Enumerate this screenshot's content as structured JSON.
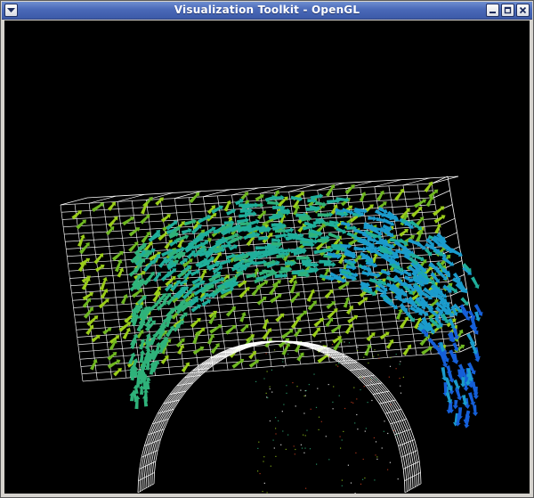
{
  "window": {
    "title": "Visualization Toolkit - OpenGL",
    "controls": [
      "minimize",
      "maximize",
      "close"
    ]
  },
  "scene": {
    "background_color": "#000000",
    "outline_color": "#ffffff",
    "vector_colors": [
      "#9acd1a",
      "#6fb821",
      "#2fb27a",
      "#1fae9a",
      "#1a9bcc",
      "#155fd8"
    ],
    "icons": {
      "window_menu": "window-menu-icon",
      "minimize": "minimize-icon",
      "maximize": "maximize-icon",
      "close": "close-icon"
    }
  }
}
